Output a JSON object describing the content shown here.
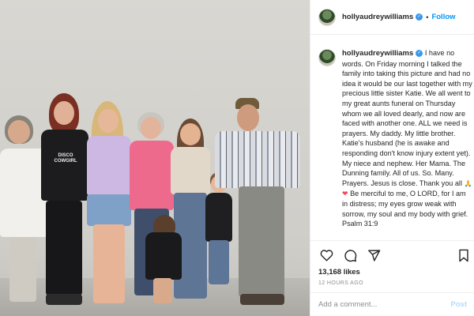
{
  "post": {
    "username": "hollyaudreywilliams",
    "follow_label": "Follow",
    "separator": "•",
    "verified_mark": "✓",
    "caption": "I have no words. On Friday morning I talked the family into taking this picture and had no idea it would be our last together with my precious little sister Katie. We all went to my great aunts funeral on Thursday whom we all loved dearly, and now are faced with another one. ALL we need is prayers. My daddy. My little brother. Katie's husband (he is awake and responding don't know injury extent yet). My niece and nephew. Her Mama. The Dunning family. All of us. So. Many. Prayers. Jesus is close. Thank you all",
    "caption_emoji_1": "🙏",
    "caption_emoji_2": "❤",
    "caption_end": "Be merciful to me, O LORD, for I am in distress; my eyes grow weak with sorrow, my soul and my body with grief. Psalm 31:9",
    "likes": "13,168 likes",
    "timestamp": "12 HOURS AGO",
    "comment_placeholder": "Add a comment...",
    "post_label": "Post"
  },
  "photo": {
    "shirt_text": "DISCO COWGIRL"
  },
  "icons": {
    "avatar": "profile-avatar",
    "like": "heart-icon",
    "comment": "comment-icon",
    "share": "paper-plane-icon",
    "save": "bookmark-icon"
  },
  "colors": {
    "accent": "#0095f6",
    "verified": "#3897f0",
    "text": "#262626",
    "muted": "#8e8e8e",
    "border": "#efefef"
  }
}
